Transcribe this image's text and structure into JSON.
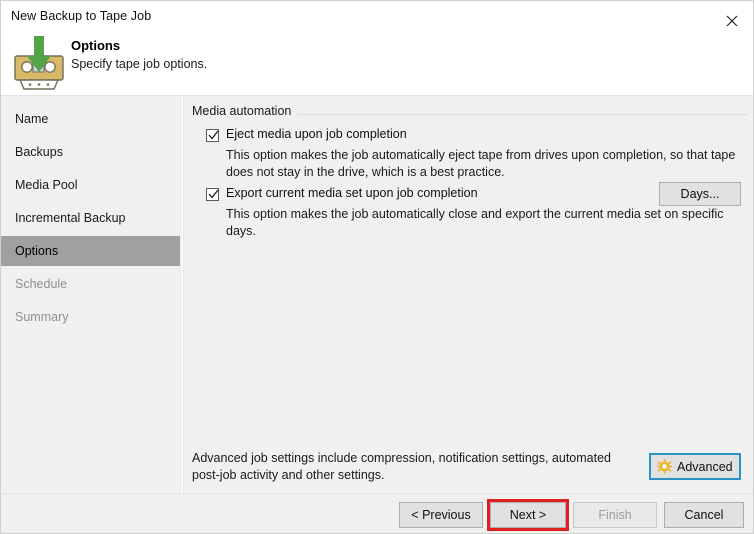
{
  "window": {
    "title": "New Backup to Tape Job",
    "close_icon": "close-icon"
  },
  "header": {
    "icon": "tape-cassette-download-icon",
    "title": "Options",
    "subtitle": "Specify tape job options."
  },
  "sidebar": {
    "items": [
      {
        "label": "Name",
        "state": "normal"
      },
      {
        "label": "Backups",
        "state": "normal"
      },
      {
        "label": "Media Pool",
        "state": "normal"
      },
      {
        "label": "Incremental Backup",
        "state": "normal"
      },
      {
        "label": "Options",
        "state": "selected"
      },
      {
        "label": "Schedule",
        "state": "disabled"
      },
      {
        "label": "Summary",
        "state": "disabled"
      }
    ]
  },
  "main": {
    "group_label": "Media automation",
    "options": [
      {
        "label": "Eject media upon job completion",
        "checked": true,
        "description": "This option makes the job automatically eject tape from drives upon completion, so that tape does not stay in the drive, which is a best practice."
      },
      {
        "label": "Export current media set upon job completion",
        "checked": true,
        "description": "This option makes the job automatically close and export the current media set on specific days."
      }
    ],
    "days_button_label": "Days...",
    "advanced_description": "Advanced job settings include compression, notification settings, automated post-job activity and other settings.",
    "advanced_button_label": "Advanced",
    "advanced_button_icon": "gear-icon"
  },
  "footer": {
    "buttons": [
      {
        "label": "< Previous",
        "state": "normal"
      },
      {
        "label": "Next >",
        "state": "highlighted"
      },
      {
        "label": "Finish",
        "state": "disabled"
      },
      {
        "label": "Cancel",
        "state": "normal"
      }
    ]
  },
  "colors": {
    "accent_focus": "#2a93c4",
    "annotation": "#e02020",
    "selection": "#a0a0a0",
    "surface": "#f0f0f0",
    "gear": "#f0b428",
    "tape_body": "#d9b968",
    "arrow_green": "#52a447"
  }
}
